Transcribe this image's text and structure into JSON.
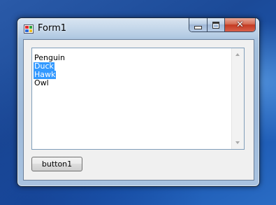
{
  "window": {
    "title": "Form1"
  },
  "listbox": {
    "items": [
      {
        "label": "Penguin",
        "selected": false
      },
      {
        "label": "Duck",
        "selected": true
      },
      {
        "label": "Hawk",
        "selected": true
      },
      {
        "label": "Owl",
        "selected": false
      }
    ]
  },
  "buttons": {
    "button1_label": "button1"
  },
  "colors": {
    "selection": "#3399ff",
    "close_button": "#c33a22"
  },
  "icons": {
    "app": "winforms-app-icon",
    "minimize": "minimize-icon",
    "maximize": "maximize-icon",
    "close": "close-icon"
  }
}
